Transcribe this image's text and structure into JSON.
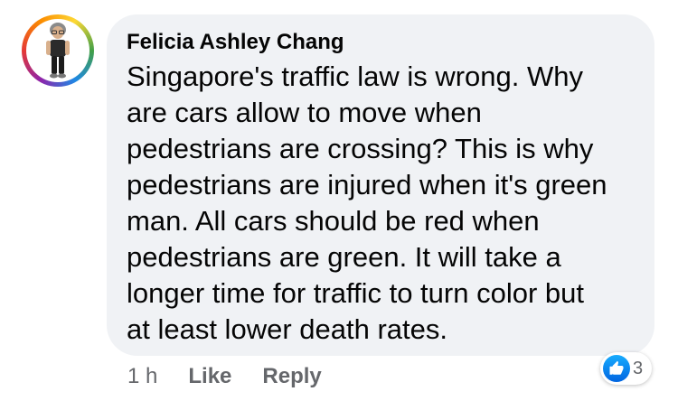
{
  "comment": {
    "author": "Felicia Ashley Chang",
    "text": "Singapore's traffic law is wrong. Why\nare cars allow to move when\npedestrians are crossing? This is why\npedestrians are injured when it's green\nman. All cars should be red when\npedestrians are green. It will take a\nlonger time for traffic to turn color but\nat least lower death rates.",
    "timestamp": "1 h",
    "actions": {
      "like": "Like",
      "reply": "Reply"
    },
    "reactions": {
      "icon": "like-thumbs-up-icon",
      "count": "3"
    }
  },
  "colors": {
    "bubble": "#f0f2f5",
    "text": "#050505",
    "meta": "#65676b",
    "like_blue": "#0866ff"
  }
}
